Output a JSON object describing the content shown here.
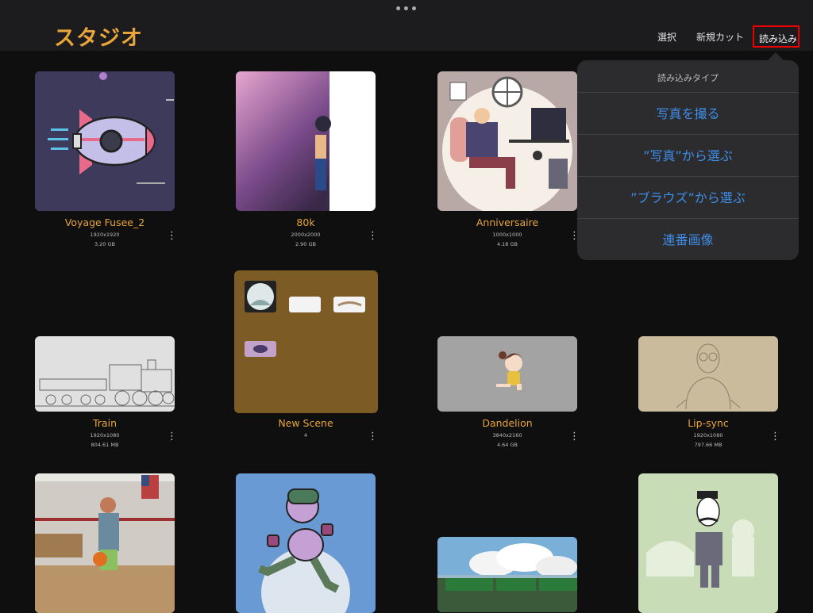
{
  "window": {
    "more_dots": "•••"
  },
  "header": {
    "title": "スタジオ",
    "select_label": "選択",
    "new_cut_label": "新規カット",
    "import_label": "読み込み"
  },
  "import_menu": {
    "title": "読み込みタイプ",
    "items": [
      "写真を撮る",
      "”写真”から選ぶ",
      "”ブラウズ”から選ぶ",
      "連番画像"
    ]
  },
  "projects": [
    {
      "name": "Voyage Fusee_2",
      "resolution": "1920x1920",
      "size": "3.20 GB"
    },
    {
      "name": "80k",
      "resolution": "2000x2000",
      "size": "2.90 GB"
    },
    {
      "name": "Anniversaire",
      "resolution": "1000x1000",
      "size": "4.18 GB"
    },
    {
      "name": "Train",
      "resolution": "1920x1080",
      "size": "804.61 MB"
    },
    {
      "name": "New Scene",
      "resolution": "4",
      "size": ""
    },
    {
      "name": "Dandelion",
      "resolution": "3840x2160",
      "size": "4.64 GB"
    },
    {
      "name": "Lip-sync",
      "resolution": "1920x1080",
      "size": "797.66 MB"
    },
    {
      "name": "",
      "resolution": "",
      "size": ""
    },
    {
      "name": "",
      "resolution": "",
      "size": ""
    },
    {
      "name": "",
      "resolution": "",
      "size": ""
    },
    {
      "name": "",
      "resolution": "",
      "size": ""
    }
  ],
  "more_icon": "⋮",
  "colors": {
    "accent": "#e8a53a",
    "link": "#3d8de8",
    "highlight": "#ee0000"
  }
}
